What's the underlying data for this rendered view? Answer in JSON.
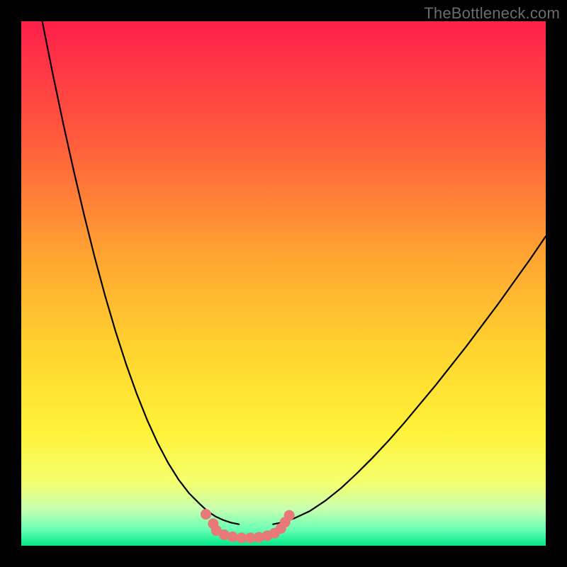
{
  "watermark": {
    "text": "TheBottleneck.com"
  },
  "chart_data": {
    "type": "line",
    "title": "",
    "xlabel": "",
    "ylabel": "",
    "ylim": [
      0,
      100
    ],
    "xlim": [
      0,
      100
    ],
    "background_gradient": {
      "stops": [
        {
          "offset": 0,
          "color": "#ff1f4b"
        },
        {
          "offset": 22,
          "color": "#ff5a3c"
        },
        {
          "offset": 45,
          "color": "#ffa531"
        },
        {
          "offset": 62,
          "color": "#ffd22e"
        },
        {
          "offset": 78,
          "color": "#fff238"
        },
        {
          "offset": 88,
          "color": "#f4ff6e"
        },
        {
          "offset": 93,
          "color": "#c7ffb0"
        },
        {
          "offset": 97,
          "color": "#66ffb3"
        },
        {
          "offset": 100,
          "color": "#00e887"
        }
      ]
    },
    "series": [
      {
        "name": "left-curve",
        "color": "#000000",
        "width": 2.2,
        "x": [
          4,
          6,
          8,
          10,
          12,
          14,
          16,
          18,
          20,
          22,
          24,
          26,
          28,
          30,
          32,
          34,
          35.5,
          37,
          38.5,
          40,
          41.5
        ],
        "y": [
          100,
          90,
          80.5,
          71.5,
          63,
          55,
          47.6,
          40.8,
          34.6,
          29,
          24,
          19.6,
          15.8,
          12.6,
          10,
          8,
          6.6,
          5.6,
          4.9,
          4.4,
          4.1
        ]
      },
      {
        "name": "right-curve",
        "color": "#000000",
        "width": 2.2,
        "x": [
          48,
          50,
          52,
          55,
          58,
          61,
          64,
          67,
          70,
          73,
          76,
          79,
          82,
          85,
          88,
          91,
          94,
          97,
          100
        ],
        "y": [
          4.1,
          4.5,
          5.2,
          6.6,
          8.6,
          11,
          13.8,
          16.8,
          20,
          23.4,
          27,
          30.6,
          34.4,
          38.2,
          42.2,
          46.2,
          50.4,
          54.6,
          59
        ]
      }
    ],
    "markers": {
      "name": "trough-dots",
      "color": "#e77a78",
      "radius": 7.5,
      "points": [
        {
          "x": 35.2,
          "y": 6.0
        },
        {
          "x": 36.6,
          "y": 4.2
        },
        {
          "x": 37.2,
          "y": 2.9
        },
        {
          "x": 38.7,
          "y": 2.1
        },
        {
          "x": 40.3,
          "y": 1.7
        },
        {
          "x": 42.0,
          "y": 1.5
        },
        {
          "x": 43.7,
          "y": 1.5
        },
        {
          "x": 45.3,
          "y": 1.6
        },
        {
          "x": 46.9,
          "y": 1.9
        },
        {
          "x": 48.3,
          "y": 2.4
        },
        {
          "x": 49.5,
          "y": 3.3
        },
        {
          "x": 50.3,
          "y": 4.5
        },
        {
          "x": 51.1,
          "y": 5.8
        }
      ]
    }
  }
}
